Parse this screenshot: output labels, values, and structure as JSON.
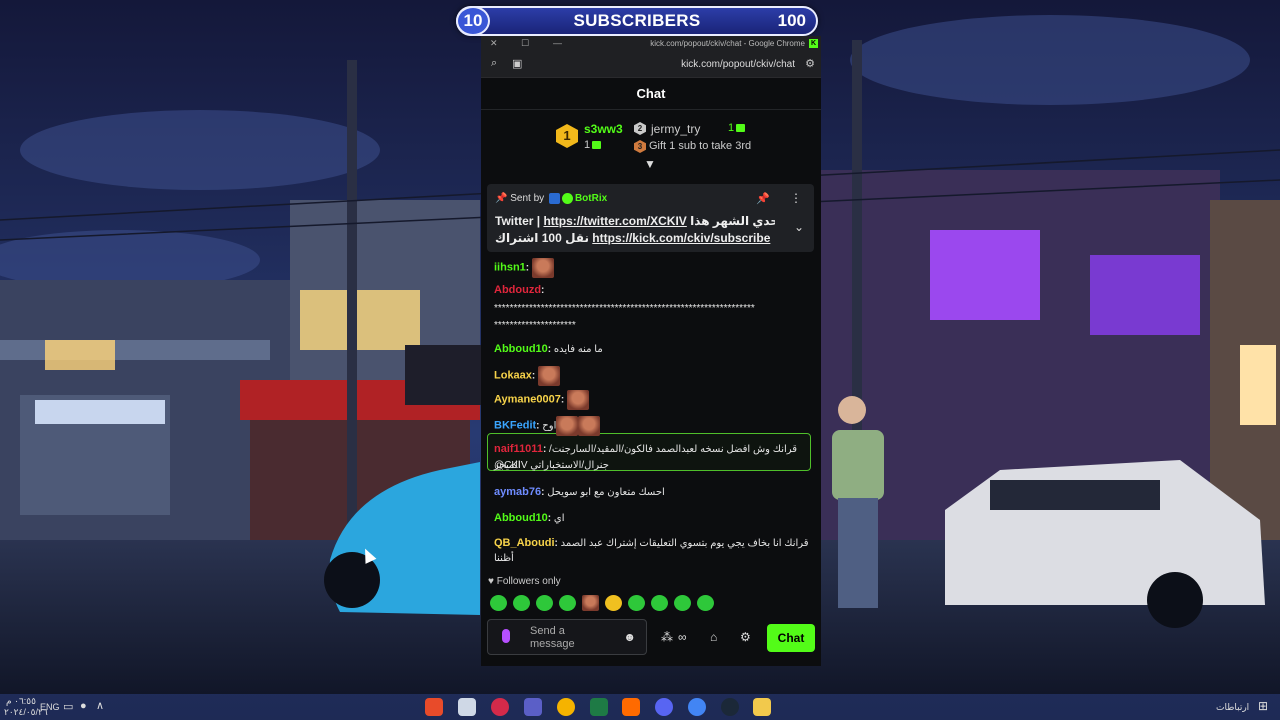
{
  "goal": {
    "current": "10",
    "label": "SUBSCRIBERS",
    "target": "100"
  },
  "window": {
    "title": "kick.com/popout/ckiv/chat - Google Chrome",
    "url": "kick.com/popout/ckiv/chat"
  },
  "chat": {
    "header": "Chat",
    "leaderboard": {
      "first": {
        "rank": "1",
        "name": "s3ww3",
        "count": "1"
      },
      "second": {
        "rank": "2",
        "name": "jermy_try",
        "count": "1"
      },
      "third": {
        "rank": "3",
        "text": "Gift 1 sub to take 3rd"
      }
    },
    "pinned": {
      "sent_by": "Sent by",
      "bot": "BotRix",
      "line1_prefix": "Twitter | ",
      "line1_link": "https://twitter.com/XCKIV",
      "line1_arabic": " تحدي الشهر هذا :",
      "line2_arabic": "نقل 100 اشتراك ",
      "line2_link": "https://kick.com/ckiv/subscribe"
    },
    "messages": [
      {
        "user": "iihsn1",
        "color": "#53fc18",
        "text": "",
        "emotes": 1
      },
      {
        "user": "Abdouzd",
        "color": "#e0263c",
        "text": "",
        "emotes": 0
      },
      {
        "user": "",
        "color": "#ffffff",
        "text": "*******************************************************************",
        "emotes": 0
      },
      {
        "user": "",
        "color": "#ffffff",
        "text": "*********************",
        "emotes": 0
      },
      {
        "user": "Abboud10",
        "color": "#53fc18",
        "text": "ما منه فايده",
        "emotes": 0
      },
      {
        "user": "Lokaax",
        "color": "#f7d34a",
        "text": "",
        "emotes": 1
      },
      {
        "user": "Aymane0007",
        "color": "#f7d34a",
        "text": "",
        "emotes": 1
      },
      {
        "user": "BKFedit",
        "color": "#3aa5ff",
        "text": "اوح",
        "emotes": 2
      },
      {
        "user": "naif11011",
        "color": "#e0263c",
        "text": "قرانك وش افضل نسخه لعبدالصمد فالكون/المقيد/السارجنت/الميجر",
        "emotes": 0
      },
      {
        "user": "",
        "color": "#ffffff",
        "text": "@CKIV جنرال/الاستخباراتي",
        "emotes": 0
      },
      {
        "user": "aymab76",
        "color": "#6f8cff",
        "text": "احسك متعاون مع ابو سويحل",
        "emotes": 0
      },
      {
        "user": "Abboud10",
        "color": "#53fc18",
        "text": "اي",
        "emotes": 0
      },
      {
        "user": "QB_Aboudi",
        "color": "#f7d34a",
        "text": "قرانك انا بخاف يجي يوم بتسوي التعليقات إشتراك عبد الصمد",
        "emotes": 0
      },
      {
        "user": "",
        "color": "#ffffff",
        "text": "أظننا",
        "emotes": 0
      }
    ],
    "followers_only": "Followers only",
    "input_placeholder": "Send a message",
    "send_label": "Chat"
  },
  "taskbar": {
    "time": "٠٦:٥٥ م",
    "date": "٢٠٢٤/٠٥/٢٦",
    "lang": "ENG",
    "links_label": "ارتباطات"
  },
  "colors": {
    "kick_green": "#53fc18",
    "goal_blue": "#2c3da8",
    "window_bg": "#0c0d0f"
  }
}
